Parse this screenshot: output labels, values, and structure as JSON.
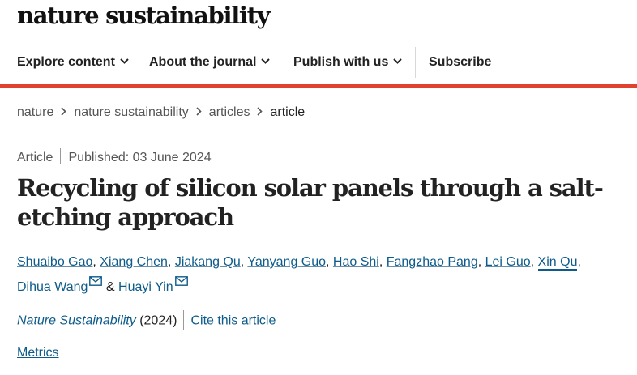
{
  "site": {
    "brand": "nature sustainability"
  },
  "nav": {
    "items": [
      {
        "label": "Explore content",
        "dropdown": true
      },
      {
        "label": "About the journal",
        "dropdown": true
      },
      {
        "label": "Publish with us",
        "dropdown": true
      },
      {
        "label": "Subscribe",
        "dropdown": false
      }
    ]
  },
  "breadcrumb": {
    "items": [
      "nature",
      "nature sustainability",
      "articles"
    ],
    "current": "article"
  },
  "article": {
    "type": "Article",
    "published": "Published: 03 June 2024",
    "title": "Recycling of silicon solar panels through a salt-etching approach",
    "authors": [
      "Shuaibo Gao",
      "Xiang Chen",
      "Jiakang Qu",
      "Yanyang Guo",
      "Hao Shi",
      "Fangzhao Pang",
      "Lei Guo",
      "Xin Qu",
      "Dihua Wang",
      "Huayi Yin"
    ],
    "author_separator": ", ",
    "author_conjunction": " & ",
    "journal": "Nature Sustainability",
    "year": "(2024)",
    "cite_label": "Cite this article",
    "metrics_label": "Metrics"
  },
  "colors": {
    "accent_red": "#e0422f",
    "link_blue": "#0d5b8a",
    "text": "#222222"
  },
  "icons": [
    "chevron-down-icon",
    "chevron-right-icon",
    "mail-icon"
  ]
}
